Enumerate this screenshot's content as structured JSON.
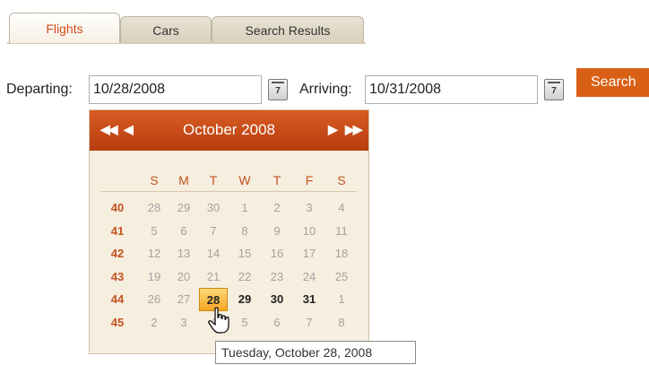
{
  "tabs": [
    {
      "label": "Flights",
      "active": true
    },
    {
      "label": "Cars",
      "active": false
    },
    {
      "label": "Search Results",
      "active": false
    }
  ],
  "form": {
    "departing_label": "Departing:",
    "departing_value": "10/28/2008",
    "arriving_label": "Arriving:",
    "arriving_value": "10/31/2008",
    "search_label": "Search"
  },
  "calendar": {
    "title": "October 2008",
    "prev_year": "◀◀",
    "prev_month": "◀",
    "next_month": "▶",
    "next_year": "▶▶",
    "weekdays": [
      "S",
      "M",
      "T",
      "W",
      "T",
      "F",
      "S"
    ],
    "weeks": [
      {
        "num": "40",
        "days": [
          "28",
          "29",
          "30",
          "1",
          "2",
          "3",
          "4"
        ],
        "current": [
          false,
          false,
          false,
          false,
          false,
          false,
          false
        ]
      },
      {
        "num": "41",
        "days": [
          "5",
          "6",
          "7",
          "8",
          "9",
          "10",
          "11"
        ],
        "current": [
          false,
          false,
          false,
          false,
          false,
          false,
          false
        ]
      },
      {
        "num": "42",
        "days": [
          "12",
          "13",
          "14",
          "15",
          "16",
          "17",
          "18"
        ],
        "current": [
          false,
          false,
          false,
          false,
          false,
          false,
          false
        ]
      },
      {
        "num": "43",
        "days": [
          "19",
          "20",
          "21",
          "22",
          "23",
          "24",
          "25"
        ],
        "current": [
          false,
          false,
          false,
          false,
          false,
          false,
          false
        ]
      },
      {
        "num": "44",
        "days": [
          "26",
          "27",
          "28",
          "29",
          "30",
          "31",
          "1"
        ],
        "current": [
          false,
          false,
          true,
          true,
          true,
          true,
          false
        ]
      },
      {
        "num": "45",
        "days": [
          "2",
          "3",
          "4",
          "5",
          "6",
          "7",
          "8"
        ],
        "current": [
          false,
          false,
          false,
          false,
          false,
          false,
          false
        ]
      }
    ],
    "selected": {
      "week": 4,
      "day": 2
    },
    "tooltip": "Tuesday, October 28, 2008",
    "calendar_icon_text": "7"
  },
  "colors": {
    "accent": "#d95f14",
    "header": "#c4471a",
    "selected": "#f5a623"
  }
}
